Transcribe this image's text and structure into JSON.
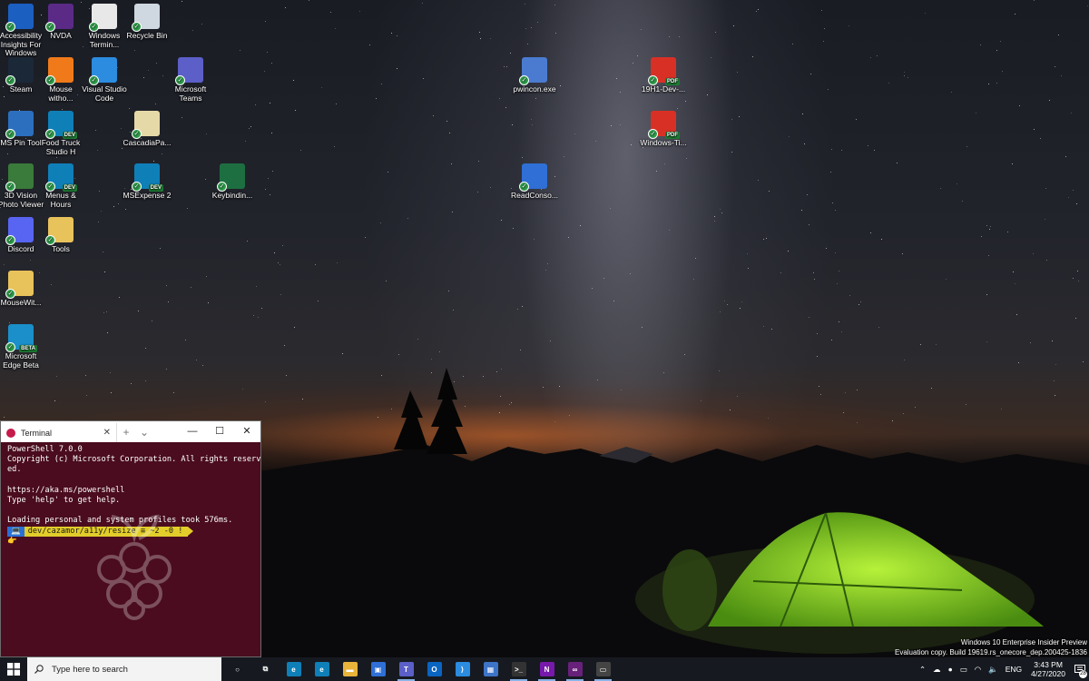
{
  "desktop": {
    "icons": [
      {
        "label": "Accessibility Insights For Windows",
        "icon": "accessibility-insights-icon",
        "color": "#1b5fc1"
      },
      {
        "label": "NVDA",
        "icon": "nvda-icon",
        "color": "#5b2a86"
      },
      {
        "label": "Windows Termin...",
        "icon": "notepad-document-icon",
        "color": "#e8e8e8"
      },
      {
        "label": "Recycle Bin",
        "icon": "recycle-bin-icon",
        "color": "#cfd8e0"
      },
      {
        "label": "Steam",
        "icon": "steam-icon",
        "color": "#1b2838"
      },
      {
        "label": "Mouse witho...",
        "icon": "mouse-without-borders-icon",
        "color": "#f07a1a"
      },
      {
        "label": "Visual Studio Code",
        "icon": "vscode-icon",
        "color": "#2b8ce0"
      },
      {
        "label": "Microsoft Teams",
        "icon": "teams-icon",
        "color": "#5b5fc7"
      },
      {
        "label": "pwincon.exe",
        "icon": "exe-app-icon",
        "color": "#4a7bd0"
      },
      {
        "label": "19H1-Dev-...",
        "icon": "pdf-icon",
        "color": "#d93025"
      },
      {
        "label": "MS Pin Tool",
        "icon": "ms-pin-tool-icon",
        "color": "#2c6fbe"
      },
      {
        "label": "Food Truck Studio H",
        "icon": "edge-dev-icon",
        "color": "#0f7fb8"
      },
      {
        "label": "CascadiaPa...",
        "icon": "text-document-icon",
        "color": "#e6d9a8"
      },
      {
        "label": "Windows-Ti...",
        "icon": "pdf-icon",
        "color": "#d93025"
      },
      {
        "label": "3D Vision Photo Viewer",
        "icon": "3d-vision-icon",
        "color": "#3a7a3a"
      },
      {
        "label": "Menus & Hours",
        "icon": "edge-dev-icon",
        "color": "#0f7fb8"
      },
      {
        "label": "MSExpense 2",
        "icon": "edge-dev-icon",
        "color": "#0f7fb8"
      },
      {
        "label": "Keybindin...",
        "icon": "excel-icon",
        "color": "#1d6f42"
      },
      {
        "label": "ReadConso...",
        "icon": "console-window-icon",
        "color": "#2f6fd6"
      },
      {
        "label": "Discord",
        "icon": "discord-icon",
        "color": "#5865f2"
      },
      {
        "label": "Tools",
        "icon": "folder-icon",
        "color": "#e8c25a"
      },
      {
        "label": "MouseWit...",
        "icon": "folder-icon",
        "color": "#e8c25a"
      },
      {
        "label": "Microsoft Edge Beta",
        "icon": "edge-beta-icon",
        "color": "#1a8fc9"
      }
    ],
    "badges": {
      "dev": "DEV",
      "beta": "BETA",
      "pdf": "PDF"
    }
  },
  "terminal": {
    "tab_title": "Terminal",
    "new_tab": "+",
    "dropdown": "⌄",
    "minimize": "—",
    "maximize": "☐",
    "close": "✕",
    "lines": [
      "PowerShell 7.0.0",
      "Copyright (c) Microsoft Corporation. All rights reserv",
      "ed.",
      "",
      "https://aka.ms/powershell",
      "Type 'help' to get help.",
      "",
      "Loading personal and system profiles took 576ms."
    ],
    "prompt_icon": "💻",
    "prompt_path": " dev/cazamor/a11y/resize ≡ ~2 -0 ! ",
    "cursor": "👉",
    "colors": {
      "background": "#4a0c1e",
      "prompt_blue": "#2a6fd6",
      "prompt_yellow": "#e2cd2a"
    }
  },
  "watermark": {
    "line1": "Windows 10 Enterprise Insider Preview",
    "line2": "Evaluation copy. Build 19619.rs_onecore_dep.200425-1836"
  },
  "taskbar": {
    "search_placeholder": "Type here to search",
    "apps": [
      {
        "name": "cortana-icon",
        "glyph": "○"
      },
      {
        "name": "task-view-icon",
        "glyph": "⧉"
      },
      {
        "name": "edge-icon",
        "glyph": "e"
      },
      {
        "name": "edge-dev-icon",
        "glyph": "e"
      },
      {
        "name": "file-explorer-icon",
        "glyph": "▬"
      },
      {
        "name": "store-icon",
        "glyph": "▣"
      },
      {
        "name": "teams-icon",
        "glyph": "T"
      },
      {
        "name": "outlook-icon",
        "glyph": "O"
      },
      {
        "name": "vscode-icon",
        "glyph": "⟩"
      },
      {
        "name": "pin-tool-icon",
        "glyph": "▦"
      },
      {
        "name": "terminal-icon",
        "glyph": ">_"
      },
      {
        "name": "onenote-icon",
        "glyph": "N"
      },
      {
        "name": "visual-studio-icon",
        "glyph": "∞"
      },
      {
        "name": "console-icon",
        "glyph": "▭"
      }
    ],
    "tray": {
      "language": "ENG",
      "time": "3:43 PM",
      "date": "4/27/2020",
      "notification_count": "28"
    }
  }
}
